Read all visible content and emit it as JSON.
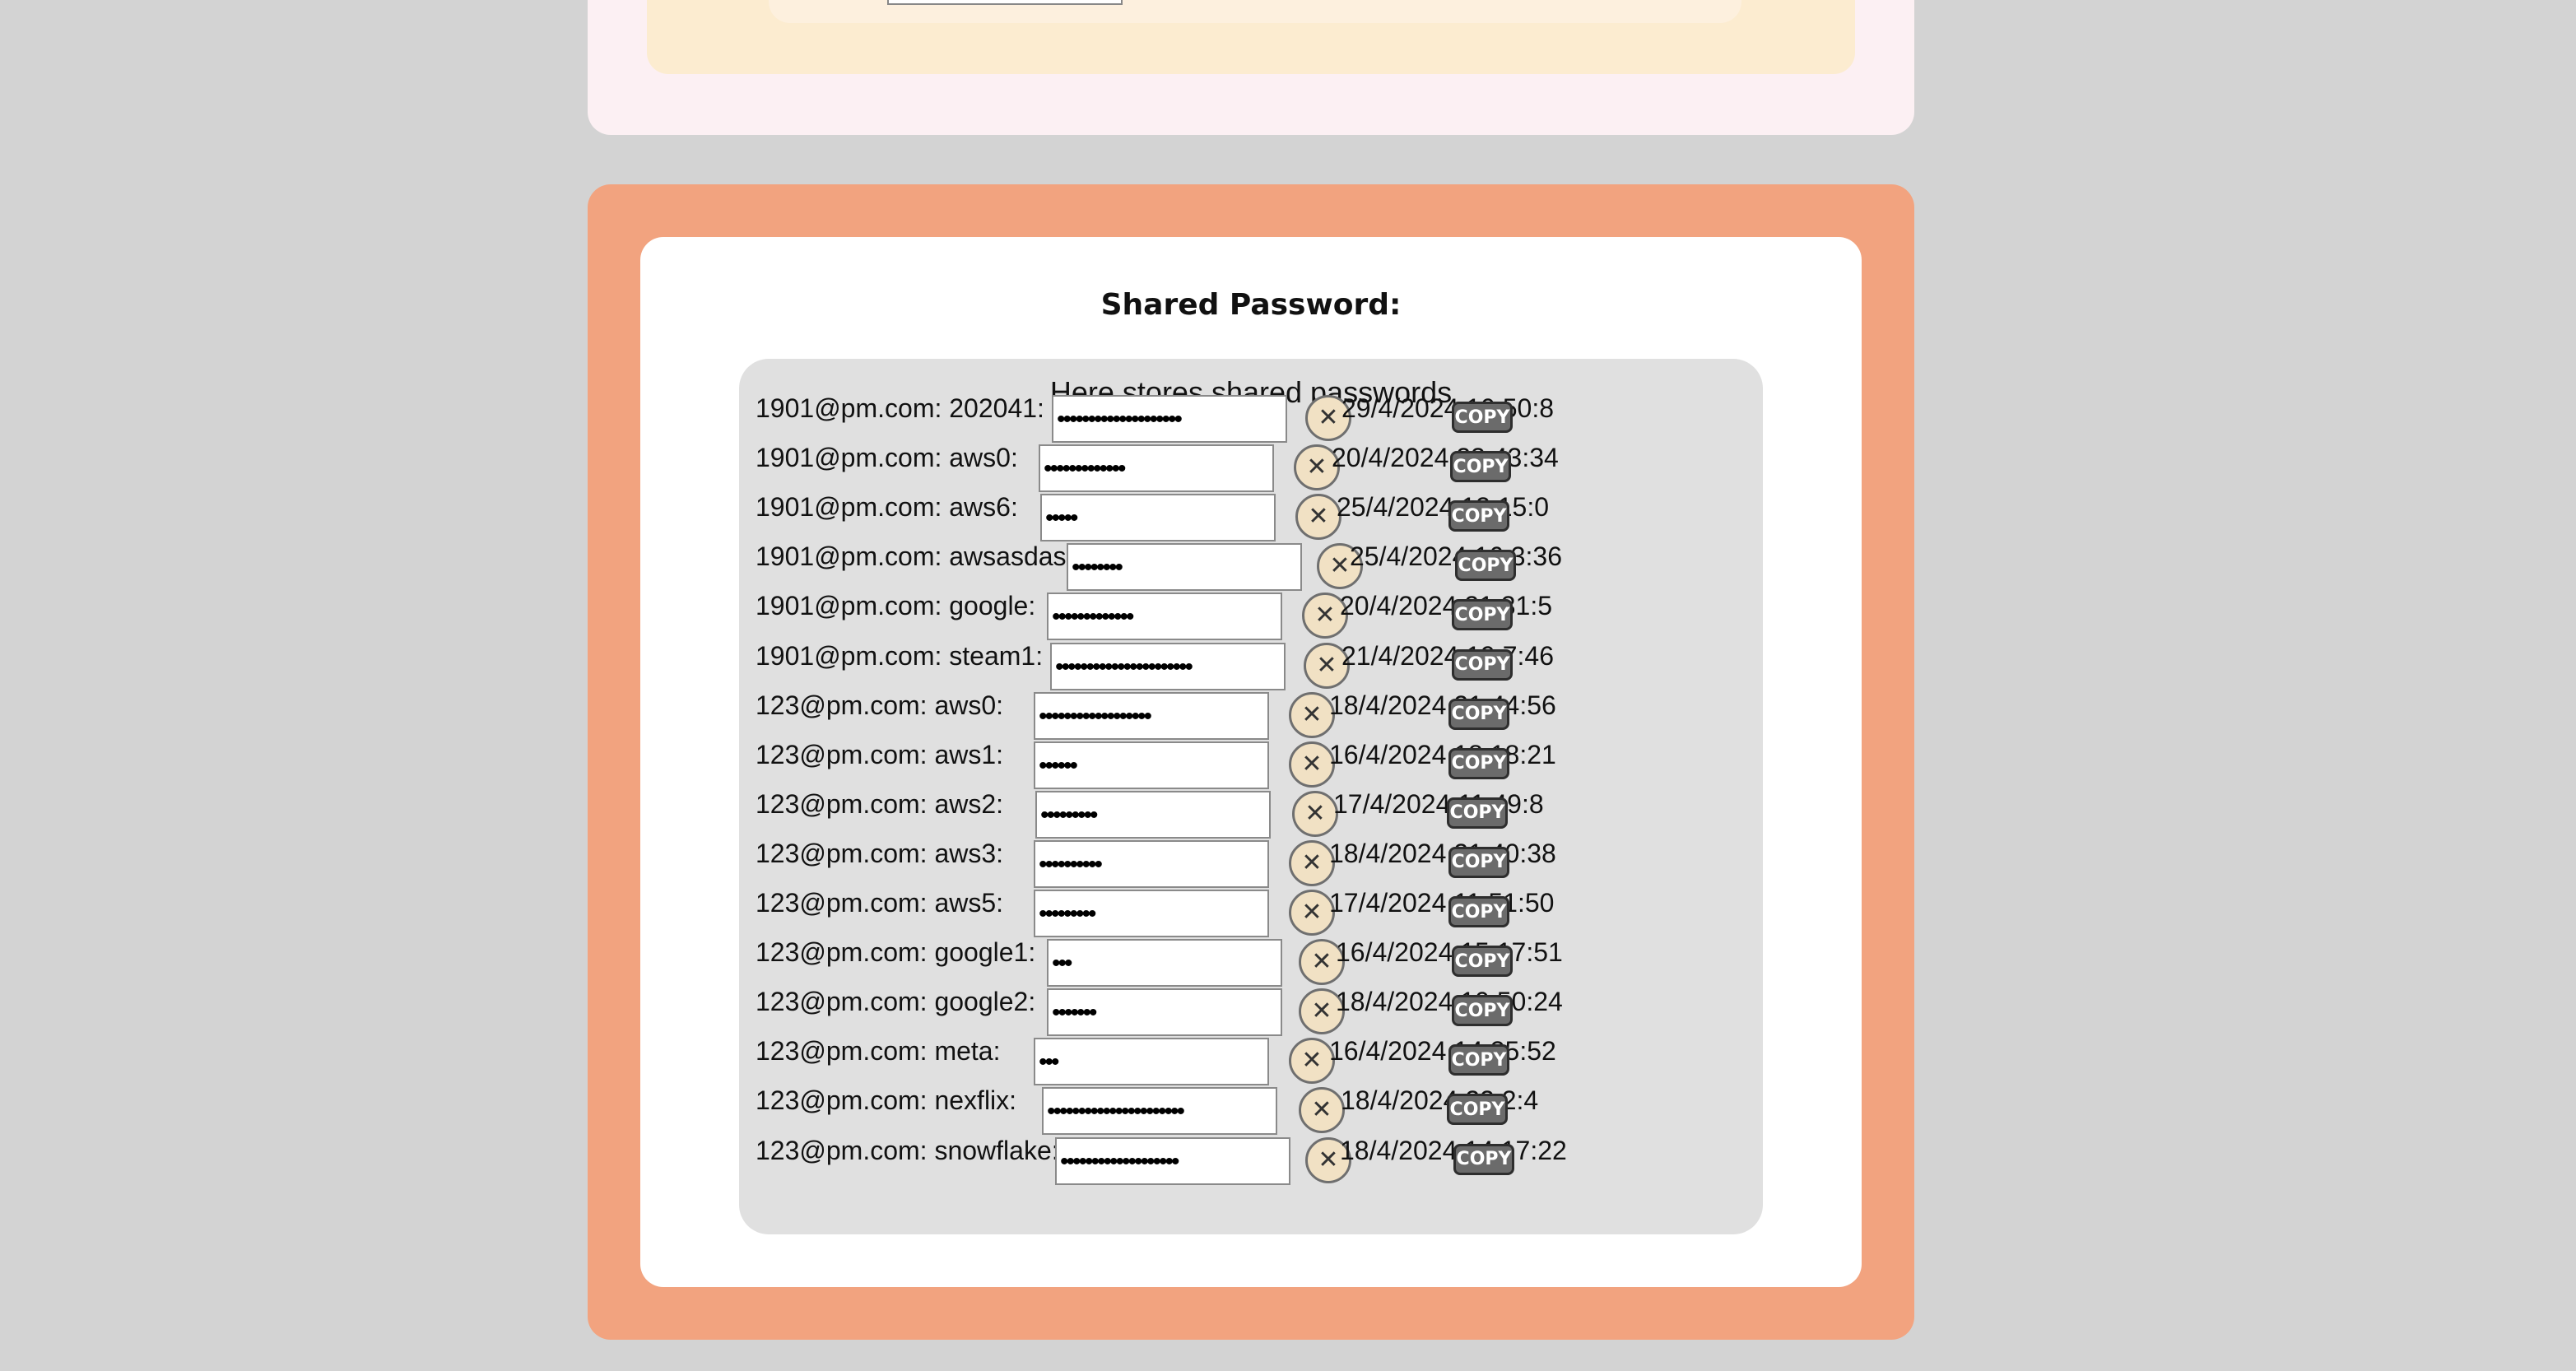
{
  "top_section": {},
  "shared": {
    "title": "Shared Password:",
    "subtitle": "Here stores shared passwords",
    "delete_icon": "close-icon",
    "rows": [
      {
        "label": "1901@pm.com: 202041:",
        "mask": "••••••••••••••••••••",
        "timestamp": "29/4/2024 10:50:8",
        "copy": "COPY"
      },
      {
        "label": "1901@pm.com: aws0:",
        "mask": "•••••••••••••",
        "timestamp": "20/4/2024 23:43:34",
        "copy": "COPY"
      },
      {
        "label": "1901@pm.com: aws6:",
        "mask": "•••••",
        "timestamp": "25/4/2024 12:15:0",
        "copy": "COPY"
      },
      {
        "label": "1901@pm.com: awsasdasd:",
        "mask": "••••••••",
        "timestamp": "25/4/2024 16:3:36",
        "copy": "COPY"
      },
      {
        "label": "1901@pm.com: google:",
        "mask": "•••••••••••••",
        "timestamp": "20/4/2024 21:31:5",
        "copy": "COPY"
      },
      {
        "label": "1901@pm.com: steam1:",
        "mask": "••••••••••••••••••••••",
        "timestamp": "21/4/2024 19:7:46",
        "copy": "COPY"
      },
      {
        "label": "123@pm.com: aws0:",
        "mask": "••••••••••••••••••",
        "timestamp": "18/4/2024 21:44:56",
        "copy": "COPY"
      },
      {
        "label": "123@pm.com: aws1:",
        "mask": "••••••",
        "timestamp": "16/4/2024 18:18:21",
        "copy": "COPY"
      },
      {
        "label": "123@pm.com: aws2:",
        "mask": "•••••••••",
        "timestamp": "17/4/2024 11:49:8",
        "copy": "COPY"
      },
      {
        "label": "123@pm.com: aws3:",
        "mask": "••••••••••",
        "timestamp": "18/4/2024 21:40:38",
        "copy": "COPY"
      },
      {
        "label": "123@pm.com: aws5:",
        "mask": "•••••••••",
        "timestamp": "17/4/2024 11:51:50",
        "copy": "COPY"
      },
      {
        "label": "123@pm.com: google1:",
        "mask": "•••",
        "timestamp": "16/4/2024 15:17:51",
        "copy": "COPY"
      },
      {
        "label": "123@pm.com: google2:",
        "mask": "•••••••",
        "timestamp": "18/4/2024 10:50:24",
        "copy": "COPY"
      },
      {
        "label": "123@pm.com: meta:",
        "mask": "•••",
        "timestamp": "16/4/2024 14:35:52",
        "copy": "COPY"
      },
      {
        "label": "123@pm.com: nexflix:",
        "mask": "••••••••••••••••••••••",
        "timestamp": "18/4/2024 22:2:4",
        "copy": "COPY"
      },
      {
        "label": "123@pm.com: snowflake:",
        "mask": "•••••••••••••••••••",
        "timestamp": "18/4/2024 14:17:22",
        "copy": "COPY"
      }
    ]
  }
}
